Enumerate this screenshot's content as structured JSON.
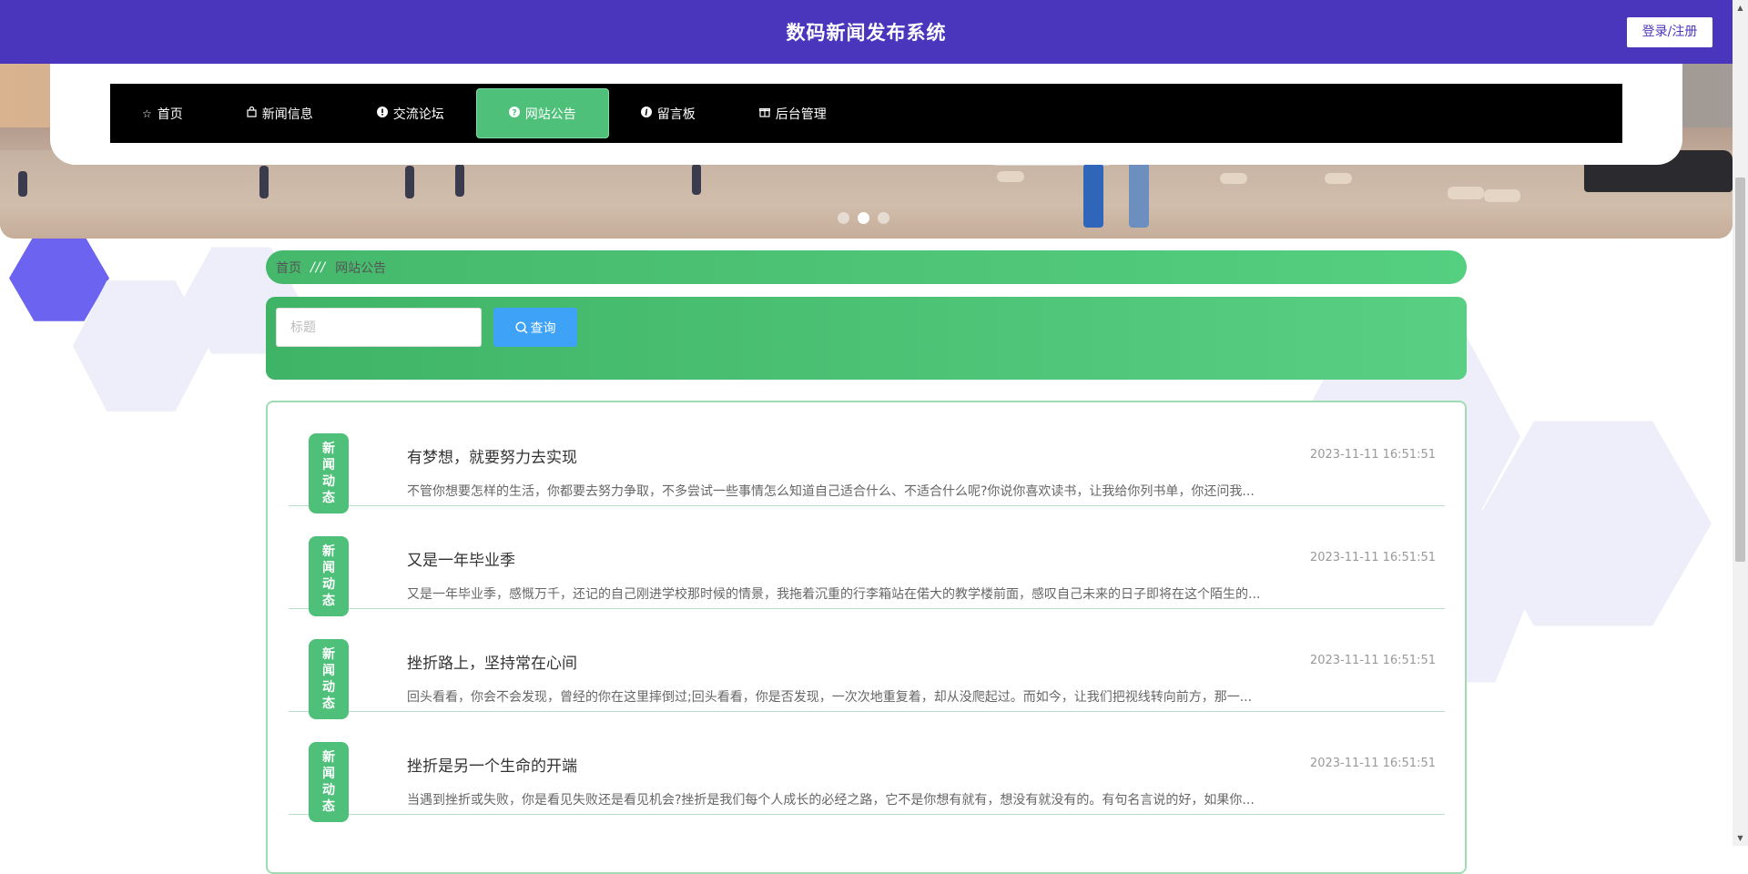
{
  "header": {
    "site_title": "数码新闻发布系统",
    "login_label": "登录/注册",
    "accent_color": "#4a35bd"
  },
  "nav": {
    "items": [
      {
        "label": "首页",
        "icon": "star-outline-icon"
      },
      {
        "label": "新闻信息",
        "icon": "shopping-bag-icon"
      },
      {
        "label": "交流论坛",
        "icon": "info-circle-icon"
      },
      {
        "label": "网站公告",
        "icon": "question-circle-icon",
        "active": true
      },
      {
        "label": "留言板",
        "icon": "italic-info-icon"
      },
      {
        "label": "后台管理",
        "icon": "gift-box-icon"
      }
    ],
    "active_color": "#4ec07a"
  },
  "banner": {
    "slide_count": 3,
    "active_slide": 2
  },
  "breadcrumb": {
    "home": "首页",
    "separator": "///",
    "current": "网站公告"
  },
  "search": {
    "placeholder": "标题",
    "value": "",
    "button_label": "查询"
  },
  "list": {
    "tag_chars": [
      "新",
      "闻",
      "动",
      "态"
    ],
    "items": [
      {
        "title": "有梦想，就要努力去实现",
        "time": "2023-11-11 16:51:51",
        "summary": "不管你想要怎样的生活，你都要去努力争取，不多尝试一些事情怎么知道自己适合什么、不适合什么呢?你说你喜欢读书，让我给你列书单，你还问我..."
      },
      {
        "title": "又是一年毕业季",
        "time": "2023-11-11 16:51:51",
        "summary": "又是一年毕业季，感慨万千，还记的自己刚进学校那时候的情景，我拖着沉重的行李箱站在偌大的教学楼前面，感叹自己未来的日子即将在这个陌生的..."
      },
      {
        "title": "挫折路上，坚持常在心间",
        "time": "2023-11-11 16:51:51",
        "summary": "回头看看，你会不会发现，曾经的你在这里摔倒过;回头看看，你是否发现，一次次地重复着，却从没爬起过。而如今，让我们把视线转向前方，那一..."
      },
      {
        "title": "挫折是另一个生命的开端",
        "time": "2023-11-11 16:51:51",
        "summary": "当遇到挫折或失败，你是看见失败还是看见机会?挫折是我们每个人成长的必经之路，它不是你想有就有，想没有就没有的。有句名言说的好，如果你..."
      }
    ]
  }
}
